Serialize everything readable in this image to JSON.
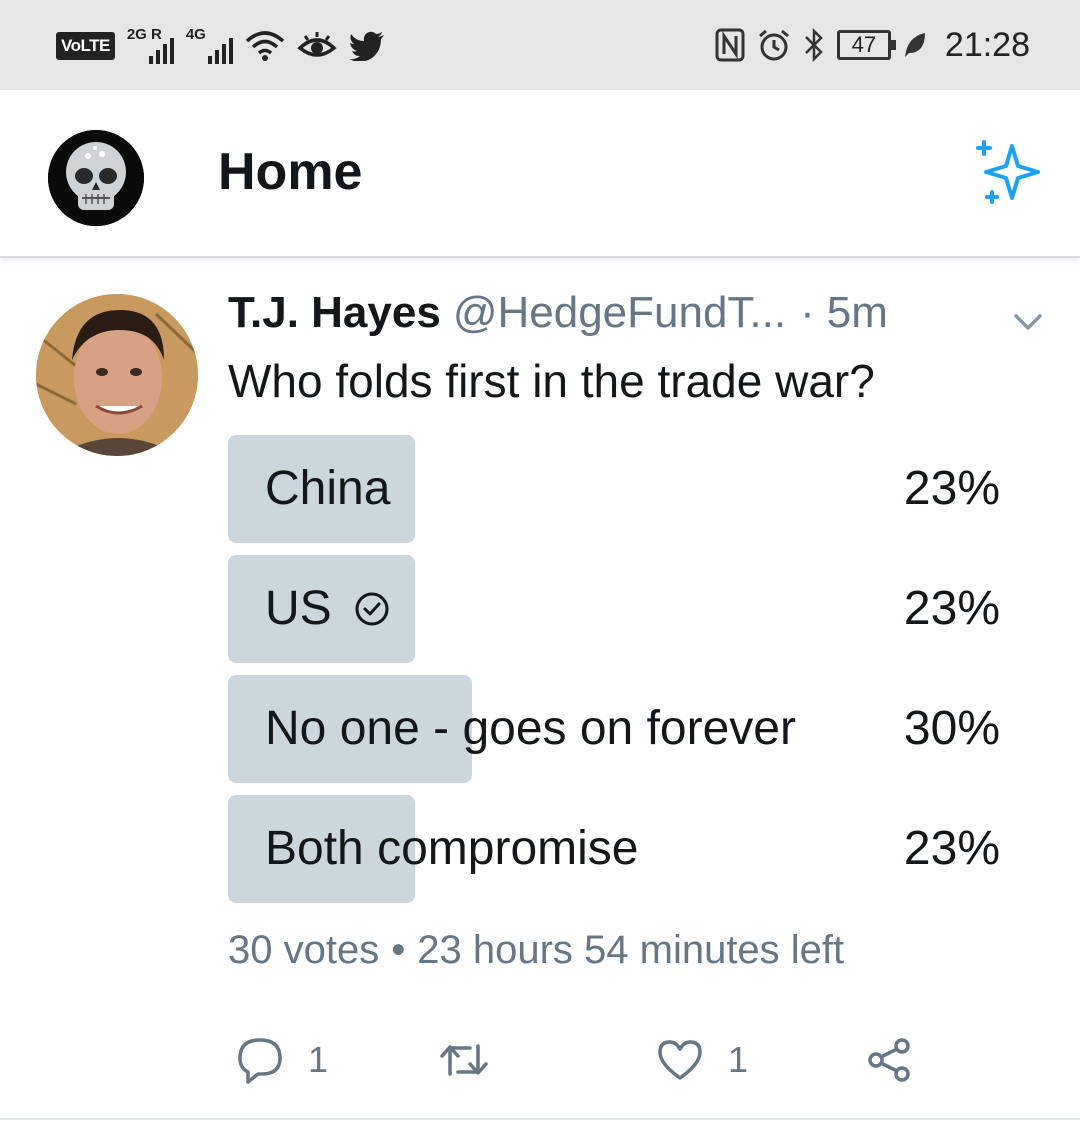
{
  "status_bar": {
    "volte": "VoLTE",
    "network_1": "2G R",
    "network_2": "4G",
    "battery": "47",
    "time": "21:28"
  },
  "header": {
    "title": "Home"
  },
  "tweet": {
    "name": "T.J. Hayes",
    "handle": "@HedgeFundT...",
    "separator": "·",
    "time": "5m",
    "text": "Who folds first in the trade war?",
    "poll": {
      "options": [
        {
          "label": "China",
          "percent_text": "23%",
          "percent": 23,
          "selected": false
        },
        {
          "label": "US",
          "percent_text": "23%",
          "percent": 23,
          "selected": true
        },
        {
          "label": "No one - goes on forever",
          "percent_text": "30%",
          "percent": 30,
          "selected": false
        },
        {
          "label": "Both compromise",
          "percent_text": "23%",
          "percent": 23,
          "selected": false
        }
      ],
      "votes": "30 votes",
      "meta_separator": "•",
      "time_left": "23 hours 54 minutes left"
    },
    "actions": {
      "reply_count": "1",
      "like_count": "1"
    }
  },
  "icons": {
    "status": [
      "signal-icon",
      "wifi-icon",
      "eye-icon",
      "twitter-bird-icon",
      "nfc-icon",
      "alarm-icon",
      "bluetooth-icon",
      "battery-icon",
      "leaf-icon"
    ],
    "header": [
      "avatar-icon",
      "sparkle-icon"
    ],
    "actions": [
      "reply-icon",
      "retweet-icon",
      "like-icon",
      "share-icon"
    ],
    "poll_selected": "check-circle-icon"
  },
  "colors": {
    "accent": "#1da1f2",
    "secondary_text": "#657786",
    "poll_bar": "#ccd6dd",
    "status_bar_bg": "#e6e6e6"
  }
}
